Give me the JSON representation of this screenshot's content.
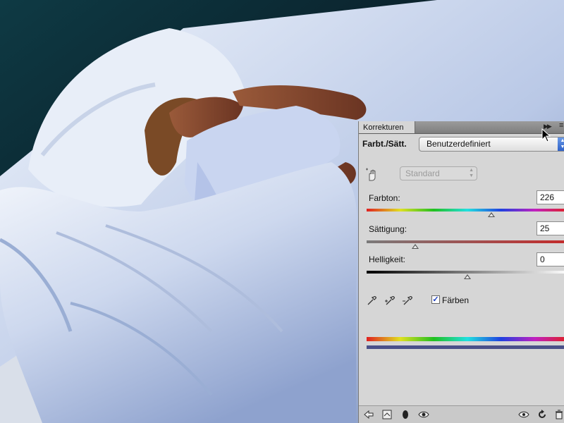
{
  "panel": {
    "tab_title": "Korrekturen",
    "preset_label": "Farbt./Sätt.",
    "preset_value": "Benutzerdefiniert",
    "channel_value": "Standard",
    "hue": {
      "label": "Farbton:",
      "value": "226",
      "position": 0.62
    },
    "saturation": {
      "label": "Sättigung:",
      "value": "25",
      "position": 0.24
    },
    "lightness": {
      "label": "Helligkeit:",
      "value": "0",
      "position": 0.5
    },
    "colorize": {
      "label": "Färben",
      "checked": true
    }
  },
  "icons": {
    "expand": "double-arrow-right-icon",
    "menu": "panel-menu-icon",
    "hand": "targeted-adjustment-hand-icon",
    "eyedroppers": [
      "eyedropper-icon",
      "eyedropper-plus-icon",
      "eyedropper-minus-icon"
    ],
    "footer": [
      "back-arrow-icon",
      "clip-to-layer-icon",
      "layer-visibility-icon",
      "eye-icon",
      "view-previous-icon",
      "reset-icon",
      "trash-icon"
    ]
  },
  "colors": {
    "panel_bg": "#d6d6d6",
    "select_accent": "#2f62c8",
    "colorized_tint": "#4a5089"
  }
}
